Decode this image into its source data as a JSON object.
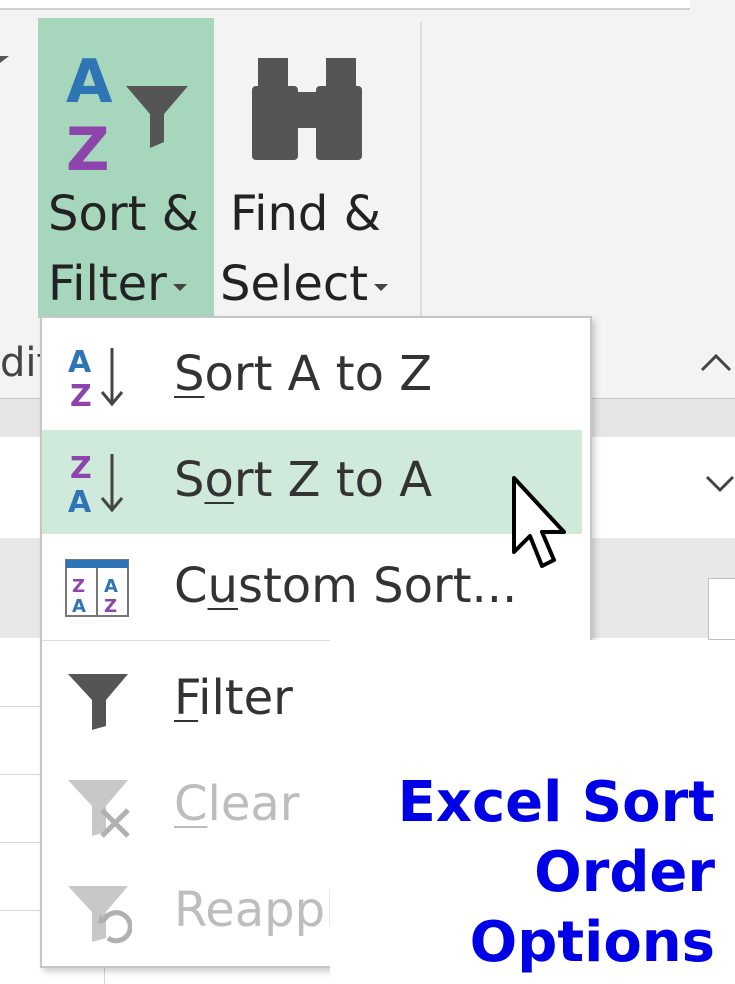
{
  "ribbon": {
    "sort_filter": {
      "line1": "Sort &",
      "line2": "Filter"
    },
    "find_select": {
      "line1": "Find &",
      "line2": "Select"
    },
    "group_label": "dit",
    "collapse_glyph": "^"
  },
  "menu": {
    "items": [
      {
        "label_pre": "",
        "label_u": "S",
        "label_post": "ort A to Z",
        "icon": "sort-ascending-icon",
        "state": "normal"
      },
      {
        "label_pre": "S",
        "label_u": "o",
        "label_post": "rt Z to A",
        "icon": "sort-descending-icon",
        "state": "hover"
      },
      {
        "label_pre": "C",
        "label_u": "u",
        "label_post": "stom Sort...",
        "icon": "custom-sort-icon",
        "state": "normal"
      },
      {
        "label_pre": "",
        "label_u": "F",
        "label_post": "ilter",
        "icon": "filter-icon",
        "state": "normal"
      },
      {
        "label_pre": "",
        "label_u": "C",
        "label_post": "lear",
        "icon": "clear-filter-icon",
        "state": "disabled"
      },
      {
        "label_pre": "",
        "label_u": "",
        "label_post": "Reappl",
        "icon": "reapply-filter-icon",
        "state": "disabled"
      }
    ]
  },
  "caption": {
    "line1": "Excel Sort",
    "line2": "Order",
    "line3": "Options"
  },
  "colors": {
    "hover_green": "#cfe9da",
    "button_green": "#a6d7bd",
    "caption_blue": "#0000e6",
    "az_blue": "#2e75b6",
    "az_purple": "#8e44ad"
  }
}
